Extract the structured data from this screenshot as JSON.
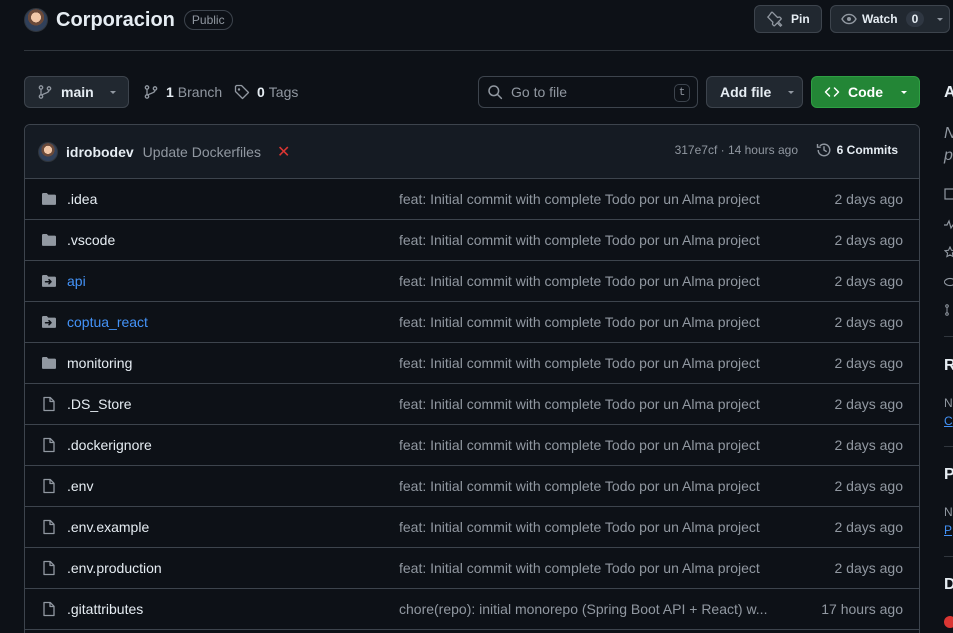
{
  "repo": {
    "name": "Corporacion",
    "visibility": "Public"
  },
  "actions": {
    "pin_label": "Pin",
    "watch_label": "Watch",
    "watch_count": "0"
  },
  "toolbar": {
    "branch": "main",
    "branch_count": "1",
    "branch_label": "Branch",
    "tag_count": "0",
    "tag_label": "Tags",
    "search_placeholder": "Go to file",
    "search_shortcut": "t",
    "add_file_label": "Add file",
    "code_label": "Code"
  },
  "latest_commit": {
    "author": "idrobodev",
    "message": "Update Dockerfiles",
    "status": "✕",
    "sha_time": "317e7cf · 14 hours ago",
    "commits_label": "6 Commits"
  },
  "files": [
    {
      "name": ".idea",
      "type": "folder",
      "message": "feat: Initial commit with complete Todo por un Alma project",
      "date": "2 days ago"
    },
    {
      "name": ".vscode",
      "type": "folder",
      "message": "feat: Initial commit with complete Todo por un Alma project",
      "date": "2 days ago"
    },
    {
      "name": "api",
      "type": "submodule",
      "message": "feat: Initial commit with complete Todo por un Alma project",
      "date": "2 days ago"
    },
    {
      "name": "coptua_react",
      "type": "submodule",
      "message": "feat: Initial commit with complete Todo por un Alma project",
      "date": "2 days ago"
    },
    {
      "name": "monitoring",
      "type": "folder",
      "message": "feat: Initial commit with complete Todo por un Alma project",
      "date": "2 days ago"
    },
    {
      "name": ".DS_Store",
      "type": "file",
      "message": "feat: Initial commit with complete Todo por un Alma project",
      "date": "2 days ago"
    },
    {
      "name": ".dockerignore",
      "type": "file",
      "message": "feat: Initial commit with complete Todo por un Alma project",
      "date": "2 days ago"
    },
    {
      "name": ".env",
      "type": "file",
      "message": "feat: Initial commit with complete Todo por un Alma project",
      "date": "2 days ago"
    },
    {
      "name": ".env.example",
      "type": "file",
      "message": "feat: Initial commit with complete Todo por un Alma project",
      "date": "2 days ago"
    },
    {
      "name": ".env.production",
      "type": "file",
      "message": "feat: Initial commit with complete Todo por un Alma project",
      "date": "2 days ago"
    },
    {
      "name": ".gitattributes",
      "type": "file",
      "message": "chore(repo): initial monorepo (Spring Boot API + React) w...",
      "date": "17 hours ago"
    }
  ],
  "sidebar_peek": {
    "about_initial": "A",
    "desc_line1": "N",
    "desc_line2": "p",
    "releases_initial": "R",
    "releases_text": "N",
    "releases_link": "C",
    "packages_initial": "P",
    "packages_text": "N",
    "packages_link": "P",
    "deployments_initial": "D"
  },
  "colors": {
    "background": "#0d1117",
    "accent_green": "#238636",
    "link_blue": "#4493f8",
    "error_red": "#da3633"
  }
}
